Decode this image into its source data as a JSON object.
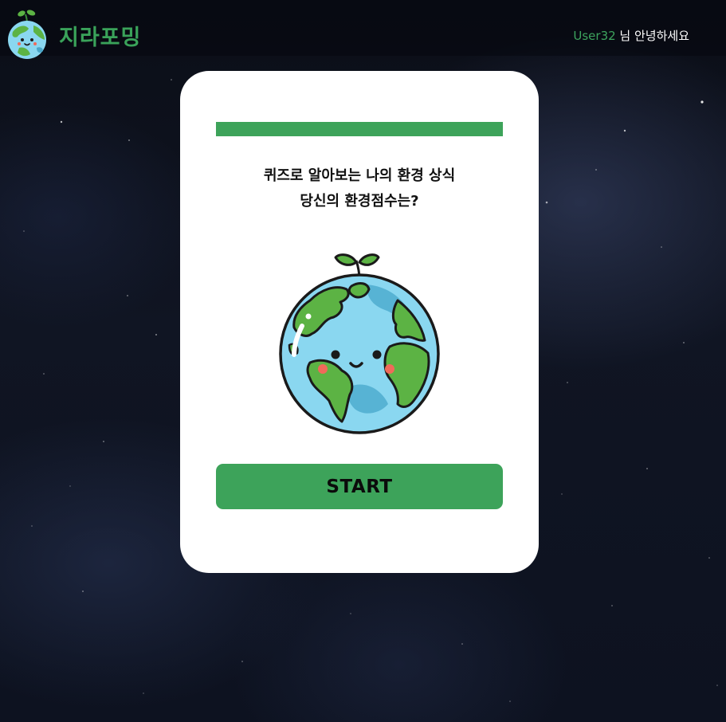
{
  "header": {
    "logo_text": "지라포밍",
    "logo_icon": "earth-mascot-icon",
    "username": "User32",
    "greeting_suffix": " 님 안녕하세요"
  },
  "quiz": {
    "progress": 1.0,
    "question_line1": "퀴즈로 알아보는 나의 환경 상식",
    "question_line2": "당신의 환경점수는?",
    "illustration": "smiling-earth-icon",
    "start_label": "START"
  },
  "colors": {
    "brand_green": "#3DA35A",
    "username_green": "#3DA35D",
    "card_background": "#FFFFFF",
    "page_background": "#0D1220"
  }
}
